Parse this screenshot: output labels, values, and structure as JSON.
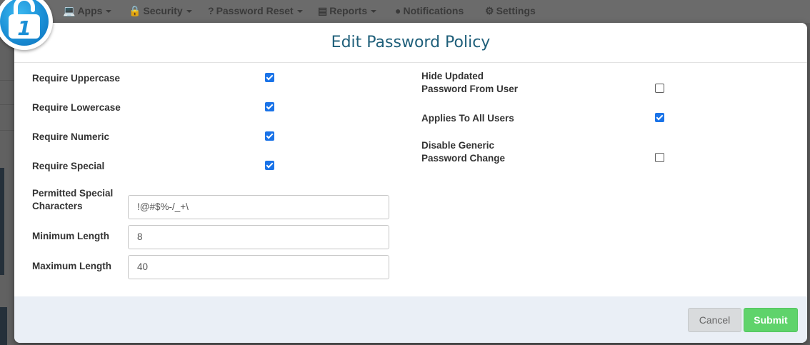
{
  "navbar": {
    "items": [
      {
        "icon": "laptop-icon",
        "label": "Apps",
        "has_caret": true
      },
      {
        "icon": "lock-icon",
        "label": "Security",
        "has_caret": true
      },
      {
        "icon": "question-icon",
        "label": "Password Reset",
        "has_caret": true
      },
      {
        "icon": "report-icon",
        "label": "Reports",
        "has_caret": true
      },
      {
        "icon": "exclamation-circle-icon",
        "label": "Notifications",
        "has_caret": false
      },
      {
        "icon": "gear-icon",
        "label": "Settings",
        "has_caret": false
      }
    ]
  },
  "logo": {
    "glyph": "1",
    "color": "#1a8fd6"
  },
  "modal": {
    "title": "Edit Password Policy",
    "left_fields": [
      {
        "label": "Require Uppercase",
        "checked": true
      },
      {
        "label": "Require Lowercase",
        "checked": true
      },
      {
        "label": "Require Numeric",
        "checked": true
      },
      {
        "label": "Require Special",
        "checked": true
      }
    ],
    "inputs": [
      {
        "label_line1": "Permitted Special",
        "label_line2": "Characters",
        "value": "!@#$%-/_+\\"
      },
      {
        "label_line1": "Minimum Length",
        "label_line2": "",
        "value": "8"
      },
      {
        "label_line1": "Maximum Length",
        "label_line2": "",
        "value": "40"
      }
    ],
    "right_fields": [
      {
        "label_line1": "Hide Updated",
        "label_line2": "Password From User",
        "checked": false
      },
      {
        "label_line1": "Applies To All Users",
        "label_line2": "",
        "checked": true
      },
      {
        "label_line1": "Disable Generic",
        "label_line2": "Password Change",
        "checked": false
      }
    ],
    "footer": {
      "cancel_label": "Cancel",
      "submit_label": "Submit"
    }
  },
  "colors": {
    "accent": "#1a73e8",
    "title": "#1f5f7a",
    "submit": "#5fd36b",
    "footer": "#eaeff6"
  }
}
